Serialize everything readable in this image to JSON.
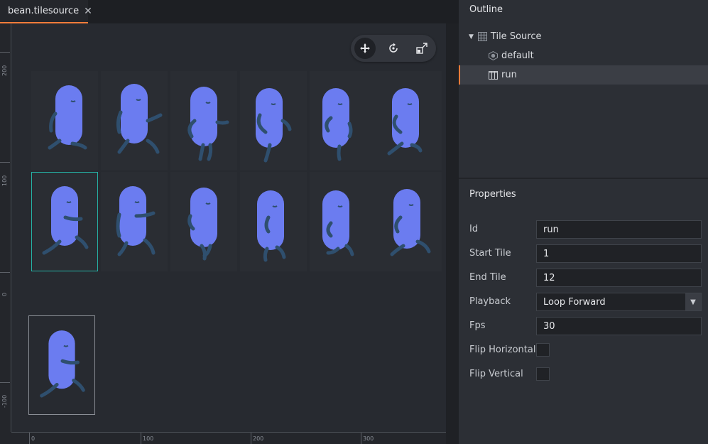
{
  "tab": {
    "label": "bean.tilesource",
    "close": "✕"
  },
  "rulers": {
    "left": [
      "200",
      "100",
      "0",
      "-100"
    ],
    "bottom": [
      "0",
      "100",
      "200",
      "300"
    ]
  },
  "toolbar": {
    "icons": [
      "move-icon",
      "rotate-icon",
      "scale-icon"
    ]
  },
  "outline": {
    "title": "Outline",
    "items": [
      {
        "label": "Tile Source",
        "icon": "grid-icon",
        "expanded": true
      },
      {
        "label": "default",
        "icon": "collision-icon"
      },
      {
        "label": "run",
        "icon": "animation-icon",
        "selected": true
      }
    ]
  },
  "properties": {
    "title": "Properties",
    "id_label": "Id",
    "id_value": "run",
    "start_label": "Start Tile",
    "start_value": "1",
    "end_label": "End Tile",
    "end_value": "12",
    "playback_label": "Playback",
    "playback_value": "Loop Forward",
    "fps_label": "Fps",
    "fps_value": "30",
    "flip_h_label": "Flip Horizontal",
    "flip_v_label": "Flip Vertical"
  },
  "colors": {
    "accent": "#f07c3a",
    "selection": "#25b2a5",
    "bean": "#6b7cf0",
    "bean_limbs": "#2f4f6e"
  }
}
